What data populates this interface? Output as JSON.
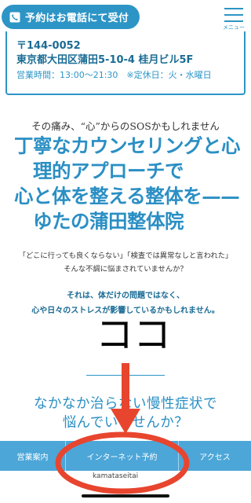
{
  "header": {
    "reserve_button_label": "予約はお電話にて受付",
    "menu_label": "メニュー"
  },
  "address_card": {
    "postal": "〒144-0052",
    "address": "東京都大田区蒲田5-10-4 桂月ビル5F",
    "hours": "営業時間：13:00〜21:30　※定休日：火・水曜日"
  },
  "hero": {
    "tagline": "その痛み、“心”からのSOSかもしれません",
    "headline_lines": [
      "丁寧なカウンセリングと心",
      "理的アプローチで",
      "心と体を整える整体を——",
      "ゆたの蒲田整体院"
    ],
    "quotes_line1": "「どこに行っても良くならない」「検査では異常なしと言われた」",
    "quotes_line2": "そんな不調に悩まされていませんか？",
    "emphasis_line1": "それは、体だけの問題ではなく、",
    "emphasis_line2": "心や日々のストレスが影響しているかもしれません。",
    "sub_headline_line1": "なかなか治らない慢性症状で",
    "sub_headline_line2": "悩んでいませんか？"
  },
  "annotation": {
    "label": "ココ",
    "color": "#e8452f"
  },
  "bottom_nav": {
    "items": [
      "営業案内",
      "インターネット予約",
      "アクセス"
    ]
  },
  "browser": {
    "url_fragment": "kamataseitai"
  },
  "colors": {
    "accent": "#2d95c6",
    "nav_bg": "#4ca6d8",
    "annotation": "#e8452f"
  }
}
